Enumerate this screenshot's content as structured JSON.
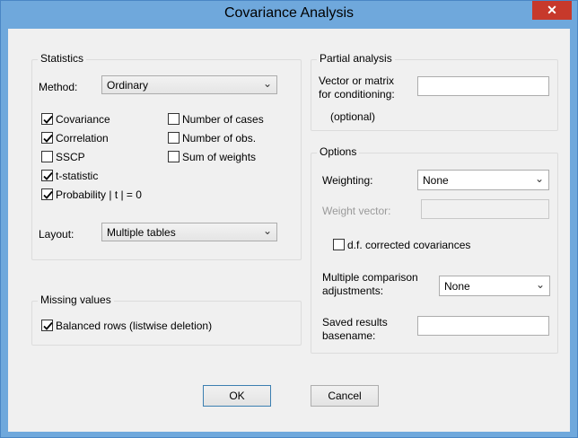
{
  "window": {
    "title": "Covariance Analysis",
    "close_glyph": "✕"
  },
  "statistics": {
    "group_title": "Statistics",
    "method_label": "Method:",
    "method_value": "Ordinary",
    "checks_left": [
      {
        "label": "Covariance",
        "checked": true
      },
      {
        "label": "Correlation",
        "checked": true
      },
      {
        "label": "SSCP",
        "checked": false
      },
      {
        "label": "t-statistic",
        "checked": true
      },
      {
        "label": "Probability | t | = 0",
        "checked": true
      }
    ],
    "checks_right": [
      {
        "label": "Number of cases",
        "checked": false
      },
      {
        "label": "Number of obs.",
        "checked": false
      },
      {
        "label": "Sum of weights",
        "checked": false
      }
    ],
    "layout_label": "Layout:",
    "layout_value": "Multiple tables"
  },
  "missing": {
    "group_title": "Missing values",
    "balanced_label": "Balanced rows (listwise deletion)",
    "balanced_checked": true
  },
  "partial": {
    "group_title": "Partial analysis",
    "vector_label_1": "Vector or matrix",
    "vector_label_2": "for conditioning:",
    "optional_label": "(optional)",
    "vector_value": ""
  },
  "options": {
    "group_title": "Options",
    "weighting_label": "Weighting:",
    "weighting_value": "None",
    "weight_vector_label": "Weight vector:",
    "weight_vector_value": "",
    "df_label": "d.f. corrected covariances",
    "df_checked": false,
    "multiple_label_1": "Multiple comparison",
    "multiple_label_2": "adjustments:",
    "multiple_value": "None",
    "saved_label_1": "Saved results",
    "saved_label_2": "basename:",
    "saved_value": ""
  },
  "buttons": {
    "ok": "OK",
    "cancel": "Cancel"
  }
}
